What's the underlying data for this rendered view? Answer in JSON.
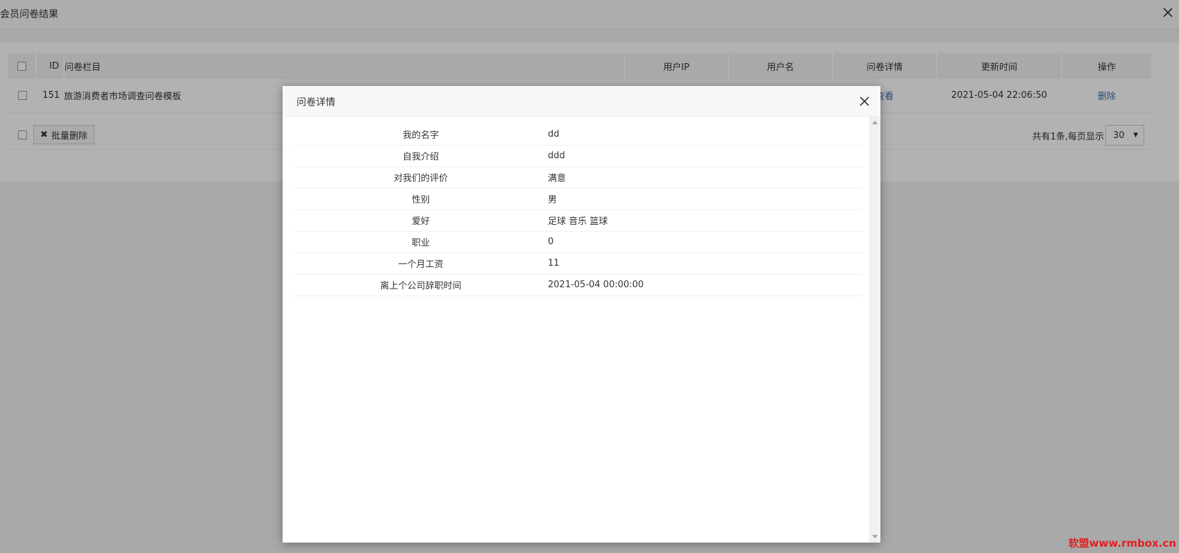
{
  "window": {
    "title": "会员问卷结果"
  },
  "table": {
    "headers": {
      "id": "ID",
      "title": "问卷栏目",
      "ip": "用户IP",
      "user": "用户名",
      "detail": "问卷详情",
      "time": "更新时间",
      "op": "操作"
    },
    "rows": [
      {
        "id": "151",
        "title": "旅游消费者市场调查问卷模板",
        "ip": "",
        "user": "",
        "detail": "查看",
        "time": "2021-05-04 22:06:50",
        "op": "删除"
      }
    ]
  },
  "footer": {
    "batch_delete": "批量删除",
    "total_text": "共有1条,每页显示",
    "page_size": "30"
  },
  "modal": {
    "title": "问卷详情",
    "items": [
      {
        "label": "我的名字",
        "value": "dd"
      },
      {
        "label": "自我介绍",
        "value": "ddd"
      },
      {
        "label": "对我们的评价",
        "value": "满意"
      },
      {
        "label": "性别",
        "value": "男"
      },
      {
        "label": "爱好",
        "value": "足球 音乐 篮球"
      },
      {
        "label": "职业",
        "value": "0"
      },
      {
        "label": "一个月工资",
        "value": "11"
      },
      {
        "label": "离上个公司辞职时间",
        "value": "2021-05-04 00:00:00"
      }
    ]
  },
  "watermark": {
    "text": "软盟www.rmbox.cn",
    "color": "#e02020"
  },
  "colors": {
    "link": "#3a6fb0",
    "overlay": "rgba(0,0,0,0.3)"
  }
}
